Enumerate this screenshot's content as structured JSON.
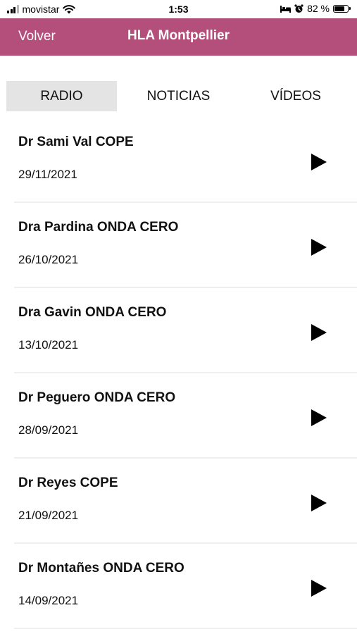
{
  "status_bar": {
    "carrier": "movistar",
    "time": "1:53",
    "battery_percent": "82 %",
    "battery_level": 0.82,
    "icons": [
      "signal-icon",
      "wifi-icon",
      "bed-icon",
      "alarm-icon",
      "battery-icon"
    ]
  },
  "header": {
    "back_label": "Volver",
    "title": "HLA Montpellier",
    "background_color": "#b44e7a"
  },
  "tabs": [
    {
      "label": "RADIO",
      "selected": true
    },
    {
      "label": "NOTICIAS",
      "selected": false
    },
    {
      "label": "VÍDEOS",
      "selected": false
    }
  ],
  "items": [
    {
      "title": "Dr Sami Val COPE",
      "date": "29/11/2021",
      "icon": "play-icon"
    },
    {
      "title": "Dra Pardina ONDA CERO",
      "date": "26/10/2021",
      "icon": "play-icon"
    },
    {
      "title": "Dra Gavin ONDA CERO",
      "date": "13/10/2021",
      "icon": "play-icon"
    },
    {
      "title": "Dr Peguero ONDA CERO",
      "date": "28/09/2021",
      "icon": "play-icon"
    },
    {
      "title": "Dr Reyes COPE",
      "date": "21/09/2021",
      "icon": "play-icon"
    },
    {
      "title": "Dr Montañes ONDA CERO",
      "date": "14/09/2021",
      "icon": "play-icon"
    }
  ]
}
